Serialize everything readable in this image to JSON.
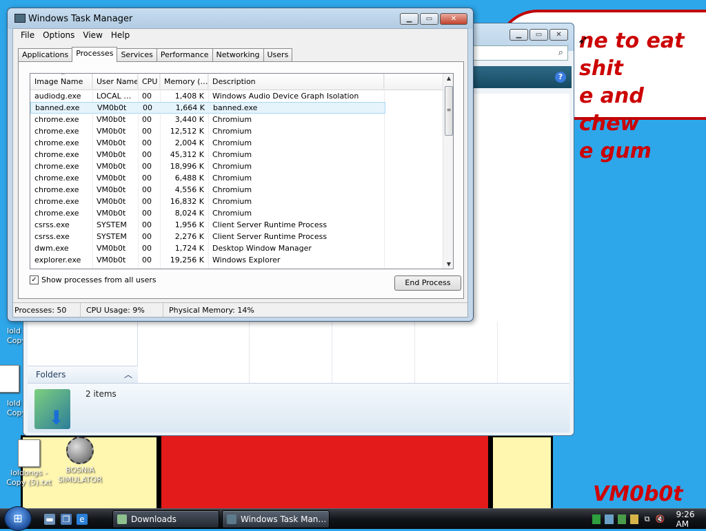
{
  "wallpaper": {
    "speech_lines": [
      "ne to eat shit",
      "e and chew",
      "e gum"
    ],
    "signature": "VM0b0t"
  },
  "desktop_icons": [
    {
      "label": "loldongs - Copy (5).txt",
      "icon": "text-file-icon"
    },
    {
      "label": "BOSNIA SIMULATOR",
      "icon": "minesweeper-icon"
    },
    {
      "label": "loldongs - Copy",
      "icon": "text-file-icon"
    },
    {
      "label": "loldongs - Copy",
      "icon": "text-file-icon"
    }
  ],
  "partial_icon_labels": [
    "lold",
    "Copy",
    "lold",
    "Copy"
  ],
  "explorer": {
    "folders_label": "Folders",
    "items_count": "2 items",
    "help_icon": "?"
  },
  "taskmgr": {
    "title": "Windows Task Manager",
    "menu": [
      "File",
      "Options",
      "View",
      "Help"
    ],
    "tabs": [
      "Applications",
      "Processes",
      "Services",
      "Performance",
      "Networking",
      "Users"
    ],
    "active_tab": "Processes",
    "columns": [
      "Image Name",
      "User Name",
      "CPU",
      "Memory (…",
      "Description"
    ],
    "processes": [
      {
        "image": "audiodg.exe",
        "user": "LOCAL …",
        "cpu": "00",
        "mem": "1,408 K",
        "desc": "Windows Audio Device Graph Isolation"
      },
      {
        "image": "banned.exe",
        "user": "VM0b0t",
        "cpu": "00",
        "mem": "1,664 K",
        "desc": "banned.exe",
        "selected": true
      },
      {
        "image": "chrome.exe",
        "user": "VM0b0t",
        "cpu": "00",
        "mem": "3,440 K",
        "desc": "Chromium"
      },
      {
        "image": "chrome.exe",
        "user": "VM0b0t",
        "cpu": "00",
        "mem": "12,512 K",
        "desc": "Chromium"
      },
      {
        "image": "chrome.exe",
        "user": "VM0b0t",
        "cpu": "00",
        "mem": "2,004 K",
        "desc": "Chromium"
      },
      {
        "image": "chrome.exe",
        "user": "VM0b0t",
        "cpu": "00",
        "mem": "45,312 K",
        "desc": "Chromium"
      },
      {
        "image": "chrome.exe",
        "user": "VM0b0t",
        "cpu": "00",
        "mem": "18,996 K",
        "desc": "Chromium"
      },
      {
        "image": "chrome.exe",
        "user": "VM0b0t",
        "cpu": "00",
        "mem": "6,488 K",
        "desc": "Chromium"
      },
      {
        "image": "chrome.exe",
        "user": "VM0b0t",
        "cpu": "00",
        "mem": "4,556 K",
        "desc": "Chromium"
      },
      {
        "image": "chrome.exe",
        "user": "VM0b0t",
        "cpu": "00",
        "mem": "16,832 K",
        "desc": "Chromium"
      },
      {
        "image": "chrome.exe",
        "user": "VM0b0t",
        "cpu": "00",
        "mem": "8,024 K",
        "desc": "Chromium"
      },
      {
        "image": "csrss.exe",
        "user": "SYSTEM",
        "cpu": "00",
        "mem": "1,956 K",
        "desc": "Client Server Runtime Process"
      },
      {
        "image": "csrss.exe",
        "user": "SYSTEM",
        "cpu": "00",
        "mem": "2,276 K",
        "desc": "Client Server Runtime Process"
      },
      {
        "image": "dwm.exe",
        "user": "VM0b0t",
        "cpu": "00",
        "mem": "1,724 K",
        "desc": "Desktop Window Manager"
      },
      {
        "image": "explorer.exe",
        "user": "VM0b0t",
        "cpu": "00",
        "mem": "19,256 K",
        "desc": "Windows Explorer"
      }
    ],
    "show_all_label": "Show processes from all users",
    "show_all_checked": true,
    "end_process_label": "End Process",
    "status": {
      "processes": "Processes: 50",
      "cpu": "CPU Usage: 9%",
      "memory": "Physical Memory: 14%"
    }
  },
  "taskbar": {
    "buttons": [
      "Downloads",
      "Windows Task Man…"
    ],
    "clock": "9:26 AM"
  }
}
